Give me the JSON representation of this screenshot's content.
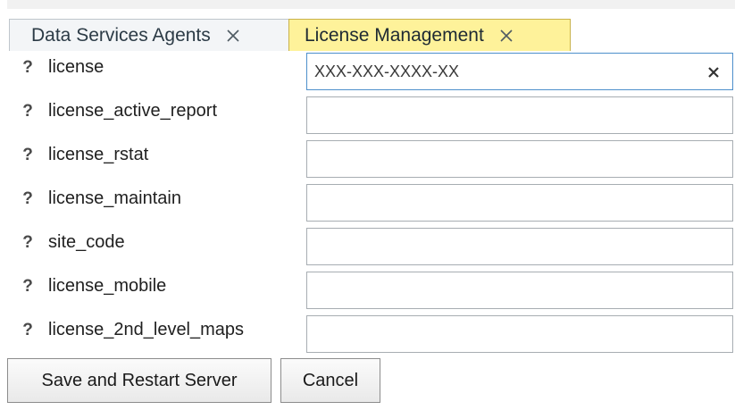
{
  "tabs": [
    {
      "label": "Data Services Agents",
      "icon": "close-icon",
      "active": false
    },
    {
      "label": "License Management",
      "icon": "close-icon",
      "active": true
    }
  ],
  "fields": [
    {
      "help": "?",
      "label": "license",
      "value": "",
      "placeholder": "XXX-XXX-XXXX-XX",
      "clear_icon": "clear-icon"
    },
    {
      "help": "?",
      "label": "license_active_report",
      "value": "",
      "placeholder": ""
    },
    {
      "help": "?",
      "label": "license_rstat",
      "value": "",
      "placeholder": ""
    },
    {
      "help": "?",
      "label": "license_maintain",
      "value": "",
      "placeholder": ""
    },
    {
      "help": "?",
      "label": "site_code",
      "value": "",
      "placeholder": ""
    },
    {
      "help": "?",
      "label": "license_mobile",
      "value": "",
      "placeholder": ""
    },
    {
      "help": "?",
      "label": "license_2nd_level_maps",
      "value": "",
      "placeholder": ""
    }
  ],
  "actions": {
    "save_label": "Save and Restart Server",
    "cancel_label": "Cancel"
  },
  "colors": {
    "active_tab": "#fef29a",
    "active_tab_border": "#c9b24a",
    "inactive_tab": "#f3f5f7",
    "focus_border": "#4d8fcb",
    "field_border": "#a7adb2"
  }
}
